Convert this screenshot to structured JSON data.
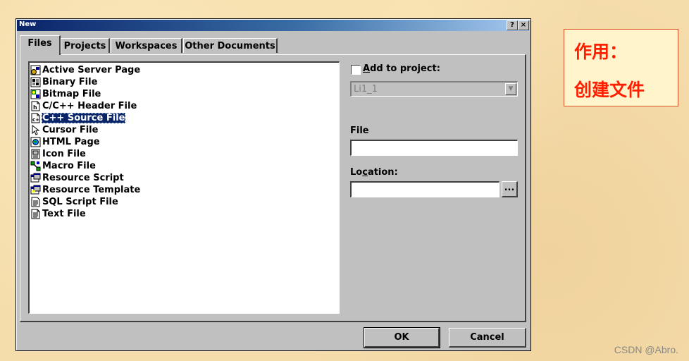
{
  "dialog": {
    "title": "New",
    "help_button": "?",
    "close_button": "×"
  },
  "tabs": [
    {
      "label": "Files",
      "active": true
    },
    {
      "label": "Projects",
      "active": false
    },
    {
      "label": "Workspaces",
      "active": false
    },
    {
      "label": "Other Documents",
      "active": false
    }
  ],
  "file_types": [
    {
      "label": "Active Server Page",
      "icon": "asp-page-icon"
    },
    {
      "label": "Binary File",
      "icon": "binary-file-icon"
    },
    {
      "label": "Bitmap File",
      "icon": "bitmap-file-icon"
    },
    {
      "label": "C/C++ Header File",
      "icon": "header-file-icon"
    },
    {
      "label": "C++ Source File",
      "icon": "cpp-source-file-icon",
      "selected": true
    },
    {
      "label": "Cursor File",
      "icon": "cursor-file-icon"
    },
    {
      "label": "HTML Page",
      "icon": "html-page-icon"
    },
    {
      "label": "Icon File",
      "icon": "icon-file-icon"
    },
    {
      "label": "Macro File",
      "icon": "macro-file-icon"
    },
    {
      "label": "Resource Script",
      "icon": "resource-script-icon"
    },
    {
      "label": "Resource Template",
      "icon": "resource-template-icon"
    },
    {
      "label": "SQL Script File",
      "icon": "sql-script-icon"
    },
    {
      "label": "Text File",
      "icon": "text-file-icon"
    }
  ],
  "add_to_project": {
    "label_prefix": "A",
    "label_rest": "dd to project:",
    "checked": false,
    "project_value": "Li1_1"
  },
  "file_field": {
    "label": "File",
    "value": ""
  },
  "location_field": {
    "label_prefix": "Lo",
    "label_ul": "c",
    "label_rest": "ation:",
    "value": "",
    "browse_label": "..."
  },
  "buttons": {
    "ok": "OK",
    "cancel": "Cancel"
  },
  "annotation": {
    "line1": "作用：",
    "line2": "创建文件",
    "color": "#ff1e00"
  },
  "watermark": "CSDN @Abro."
}
